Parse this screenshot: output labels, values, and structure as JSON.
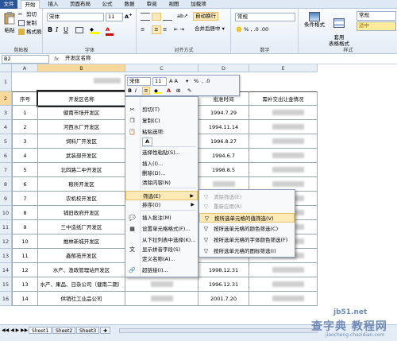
{
  "tabs": [
    "文件",
    "开始",
    "插入",
    "页面布局",
    "公式",
    "数据",
    "审阅",
    "视图",
    "加载项"
  ],
  "ribbon": {
    "clipboard": {
      "paste": "粘贴",
      "cut": "剪切",
      "copy": "复制",
      "format_painter": "格式刷",
      "label": "剪贴板"
    },
    "font": {
      "name": "宋体",
      "size": "11",
      "label": "字体"
    },
    "alignment": {
      "wrap": "自动换行",
      "merge": "合并后居中",
      "label": "对齐方式"
    },
    "number": {
      "format": "常规",
      "label": "数字"
    },
    "styles": {
      "conditional": "条件格式",
      "table": "套用\n表格格式",
      "style_normal": "常规",
      "style_medium": "适中",
      "label": "样式"
    }
  },
  "formula_bar": {
    "name_box": "B2",
    "fx": "fx",
    "value": "开发区名称"
  },
  "columns": [
    "A",
    "B",
    "C",
    "D",
    "E"
  ],
  "rows": [
    {
      "num": "1",
      "cells": [
        "",
        "",
        "",
        "",
        ""
      ]
    },
    {
      "num": "2",
      "cells": [
        "序号",
        "开发区名称",
        "批准文号",
        "批准时间",
        "需补交出让金情况"
      ]
    },
    {
      "num": "3",
      "cells": [
        "1",
        "健南市场开发区",
        "",
        "1994.7.29",
        ""
      ]
    },
    {
      "num": "4",
      "cells": [
        "2",
        "河西水厂开发区",
        "",
        "1994.11.14",
        ""
      ]
    },
    {
      "num": "5",
      "cells": [
        "3",
        "饲料厂开发区",
        "",
        "1996.8.27",
        ""
      ]
    },
    {
      "num": "6",
      "cells": [
        "4",
        "武装部开发区",
        "",
        "1994.6.7",
        ""
      ]
    },
    {
      "num": "7",
      "cells": [
        "5",
        "北四路二中开发区",
        "",
        "1998.8.5",
        ""
      ]
    },
    {
      "num": "8",
      "cells": [
        "6",
        "粮所开发区",
        "",
        "",
        ""
      ]
    },
    {
      "num": "9",
      "cells": [
        "7",
        "农机校开发区",
        "",
        "",
        ""
      ]
    },
    {
      "num": "10",
      "cells": [
        "8",
        "铺旧政府开发区",
        "",
        "",
        ""
      ]
    },
    {
      "num": "11",
      "cells": [
        "9",
        "三中造纸厂开发区",
        "",
        "",
        ""
      ]
    },
    {
      "num": "12",
      "cells": [
        "10",
        "推林新城开发区",
        "",
        "",
        ""
      ]
    },
    {
      "num": "13",
      "cells": [
        "11",
        "鑫郁苑开发区",
        "",
        "1996.5.27",
        ""
      ]
    },
    {
      "num": "14",
      "cells": [
        "12",
        "水产、渔政管理站开发区",
        "",
        "1998.12.31",
        ""
      ]
    },
    {
      "num": "15",
      "cells": [
        "13",
        "水产、果品、日杂公司（健南二期）",
        "",
        "1996.12.31",
        ""
      ]
    },
    {
      "num": "16",
      "cells": [
        "14",
        "供销社工业品公司",
        "",
        "2001.7.20",
        ""
      ]
    }
  ],
  "title_suffix": "表",
  "mini_toolbar": {
    "font": "宋体",
    "size": "11",
    "percent": "%"
  },
  "context_menu": [
    {
      "icon": "scissors-icon",
      "label": "剪切(T)"
    },
    {
      "icon": "copy-icon",
      "label": "复制(C)"
    },
    {
      "icon": "paste-icon",
      "label": "粘贴选项:"
    },
    {
      "icon": "paste-a-icon",
      "label": "A"
    },
    {
      "icon": "",
      "label": "选择性粘贴(S)..."
    },
    {
      "icon": "",
      "label": "插入(I)..."
    },
    {
      "icon": "",
      "label": "删除(D)..."
    },
    {
      "icon": "",
      "label": "清除内容(N)"
    },
    {
      "icon": "",
      "label": "筛选(E)"
    },
    {
      "icon": "",
      "label": "排序(O)"
    },
    {
      "icon": "comment-icon",
      "label": "插入批注(M)"
    },
    {
      "icon": "format-cells-icon",
      "label": "设置单元格格式(F)..."
    },
    {
      "icon": "",
      "label": "从下拉列表中选择(K)..."
    },
    {
      "icon": "phonetic-icon",
      "label": "显示拼音字段(S)"
    },
    {
      "icon": "",
      "label": "定义名称(A)..."
    },
    {
      "icon": "hyperlink-icon",
      "label": "超链接(I)..."
    }
  ],
  "submenu": [
    {
      "label": "清除筛选(E)",
      "disabled": true
    },
    {
      "label": "重新应用(R)",
      "disabled": true
    },
    {
      "label": "按所选单元格的值筛选(V)",
      "disabled": false
    },
    {
      "label": "按所选单元格的颜色筛选(C)",
      "disabled": false
    },
    {
      "label": "按所选单元格的字体颜色筛选(F)",
      "disabled": false
    },
    {
      "label": "按所选单元格的图标筛选(I)",
      "disabled": false
    }
  ],
  "sheets": [
    "Sheet1",
    "Sheet2",
    "Sheet3"
  ],
  "watermark": {
    "line1": "jb51.net",
    "line2": "查字典 教程网",
    "line3": "jiaocheng.chazidian.com"
  },
  "colors": {
    "accent": "#2a5699",
    "highlight": "#fbe9b7",
    "ribbon": "#e4ecf6"
  }
}
